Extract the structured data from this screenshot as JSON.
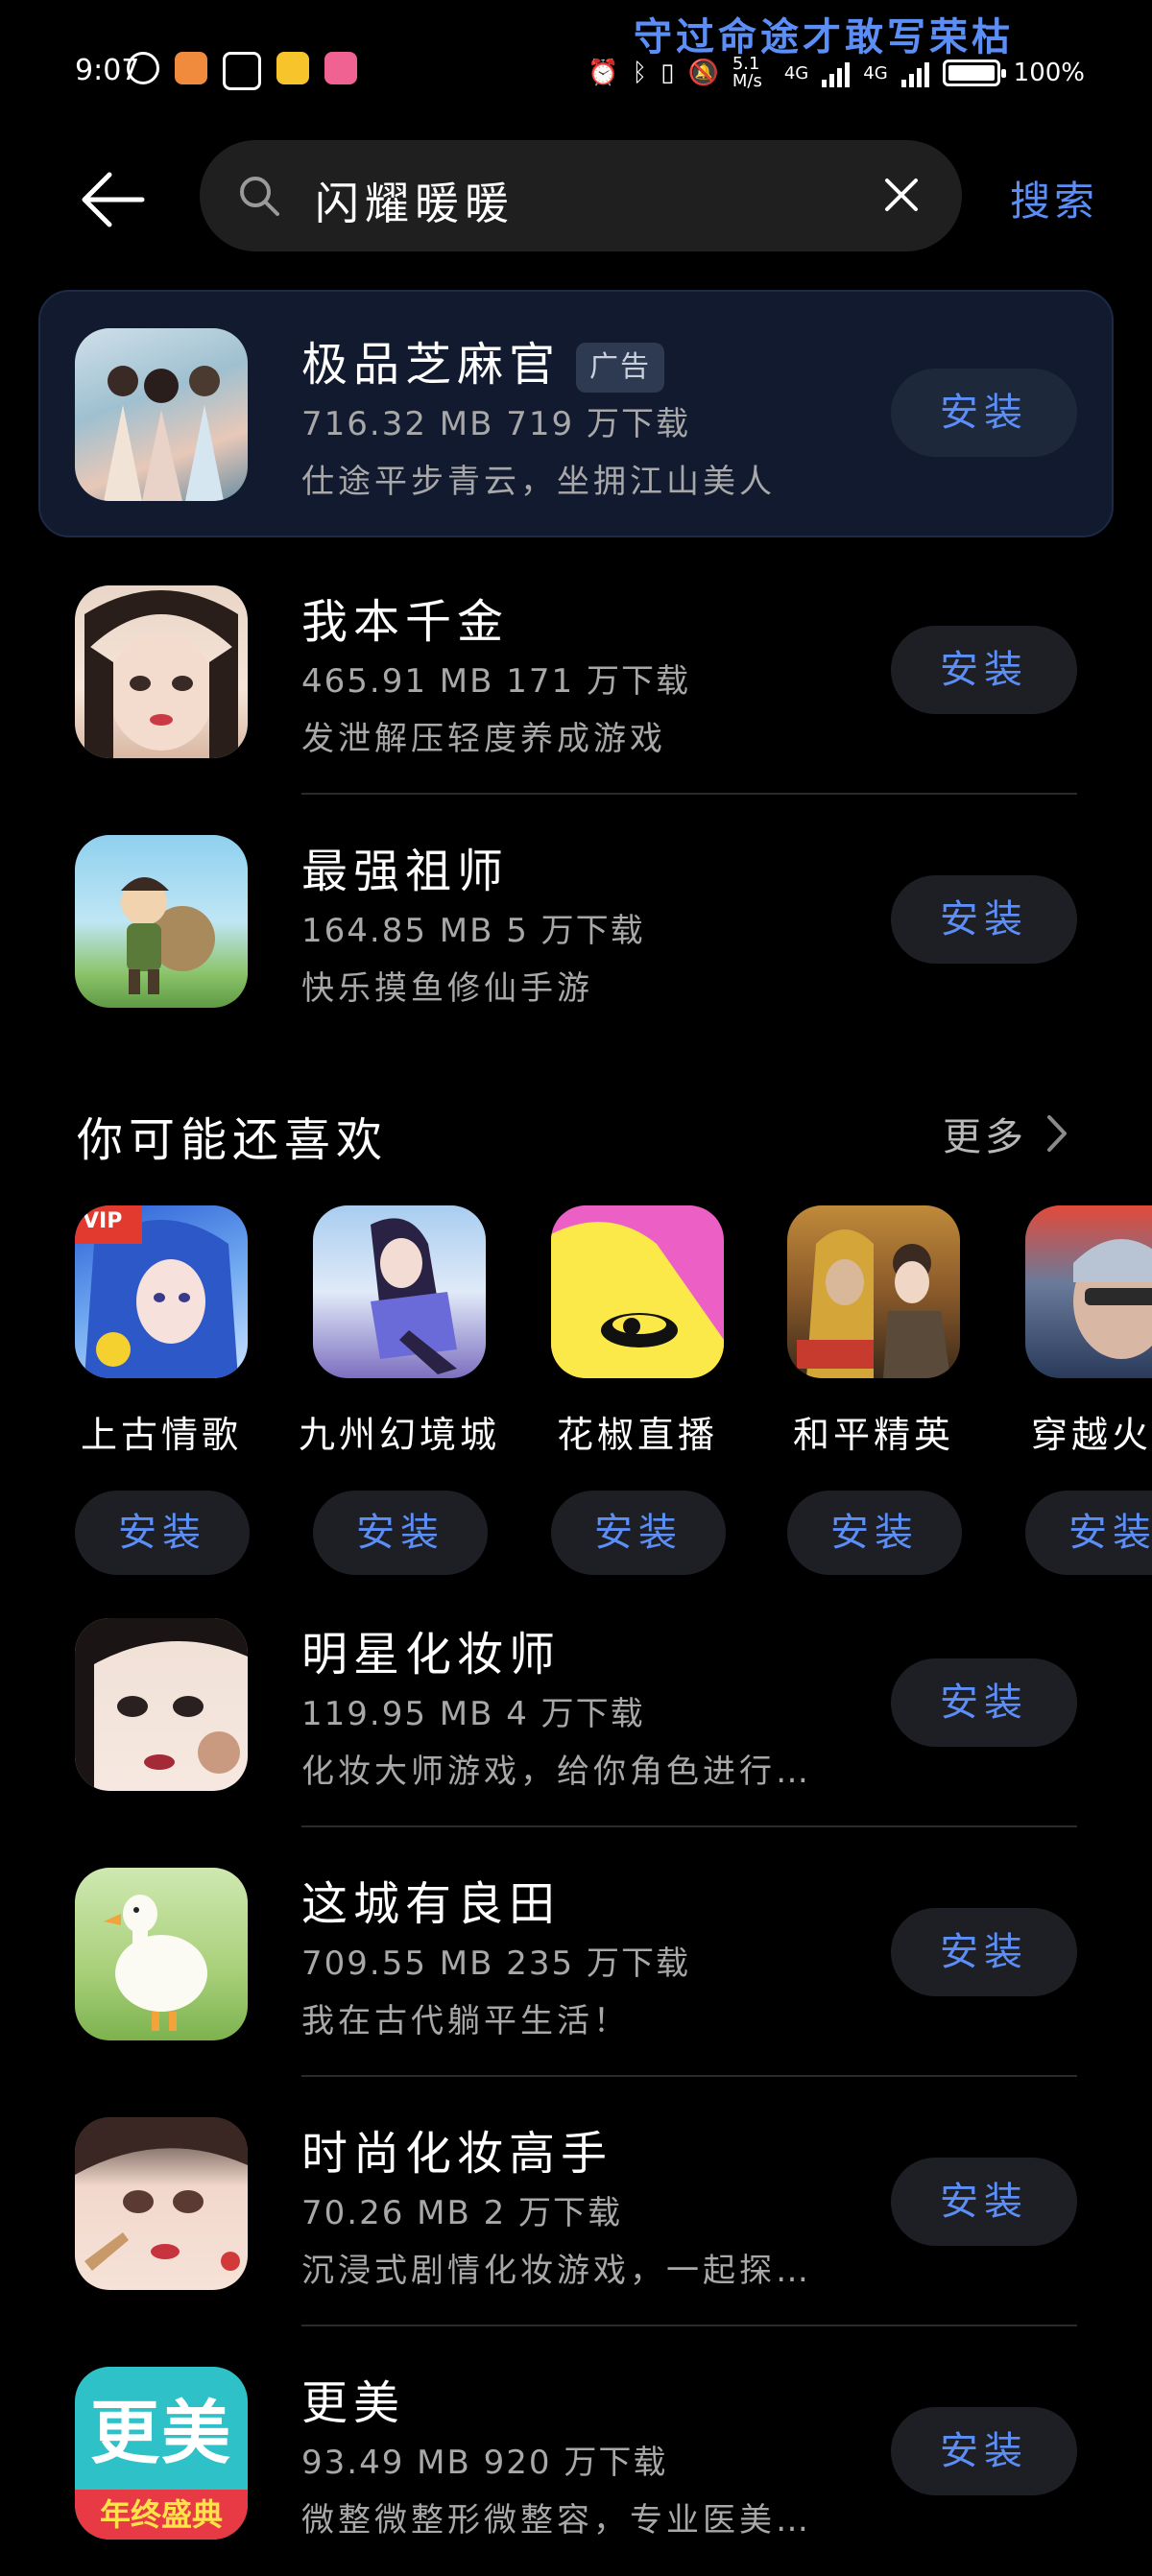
{
  "status_bar": {
    "time": "9:07",
    "banner_text": "守过命途才敢写荣枯",
    "network_speed": "5.1 M/s",
    "signal_1": "4G",
    "signal_2": "4G",
    "battery": "100%"
  },
  "header": {
    "search_query": "闪耀暖暖",
    "search_button": "搜索"
  },
  "results": [
    {
      "name": "极品芝麻官",
      "badge": "广告",
      "meta": "716.32 MB 719 万下载",
      "desc": "仕途平步青云，坐拥江山美人",
      "install": "安装"
    },
    {
      "name": "我本千金",
      "meta": "465.91 MB 171 万下载",
      "desc": "发泄解压轻度养成游戏",
      "install": "安装"
    },
    {
      "name": "最强祖师",
      "meta": "164.85 MB 5 万下载",
      "desc": "快乐摸鱼修仙手游",
      "install": "安装"
    }
  ],
  "recommend": {
    "title": "你可能还喜欢",
    "more": "更多",
    "apps": [
      {
        "name": "上古情歌",
        "install": "安装"
      },
      {
        "name": "九州幻境城",
        "install": "安装"
      },
      {
        "name": "花椒直播",
        "install": "安装"
      },
      {
        "name": "和平精英",
        "install": "安装"
      },
      {
        "name": "穿越火线",
        "install": "安装"
      }
    ]
  },
  "more_results": [
    {
      "name": "明星化妆师",
      "meta": "119.95 MB 4 万下载",
      "desc": "化妆大师游戏，给你角色进行…",
      "install": "安装"
    },
    {
      "name": "这城有良田",
      "meta": "709.55 MB 235 万下载",
      "desc": "我在古代躺平生活！",
      "install": "安装"
    },
    {
      "name": "时尚化妆高手",
      "meta": "70.26 MB 2 万下载",
      "desc": "沉浸式剧情化妆游戏，一起探…",
      "install": "安装"
    },
    {
      "name": "更美",
      "meta": "93.49 MB 920 万下载",
      "desc": "微整微整形微整容，专业医美…",
      "install": "安装"
    }
  ],
  "icon_text": {
    "gengmei_logo": "更美",
    "gengmei_sub": "年终盛典",
    "vip": "VIP"
  },
  "colors": {
    "accent": "#5b8ff7",
    "background": "#000000",
    "button_bg": "#1e1f24",
    "ad_bg": "#111a2e"
  }
}
